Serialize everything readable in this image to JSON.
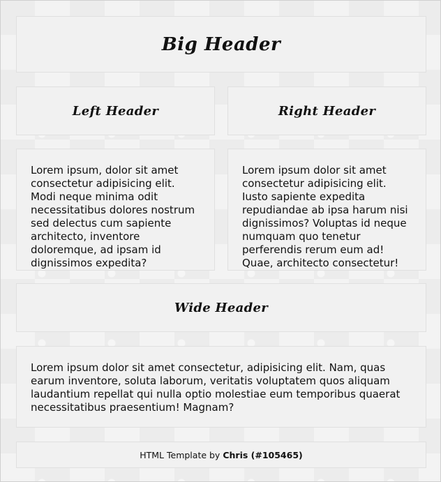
{
  "big_header": "Big Header",
  "left_header": "Left Header",
  "right_header": "Right Header",
  "left_text": "Lorem ipsum, dolor sit amet consectetur adipisicing elit. Modi neque minima odit necessitatibus dolores nostrum sed delectus cum sapiente architecto, inventore doloremque, ad ipsam id dignissimos expedita?",
  "right_text": "Lorem ipsum dolor sit amet consectetur adipisicing elit. Iusto sapiente expedita repudiandae ab ipsa harum nisi dignissimos? Voluptas id neque numquam quo tenetur perferendis rerum eum ad! Quae, architecto consectetur!",
  "wide_header": "Wide Header",
  "wide_text": "Lorem ipsum dolor sit amet consectetur, adipisicing elit. Nam, quas earum inventore, soluta laborum, veritatis voluptatem quos aliquam laudantium repellat qui nulla optio molestiae eum temporibus quaerat necessitatibus praesentium! Magnam?",
  "footer": {
    "prefix": "HTML Template by",
    "author": "Chris (#105465)"
  }
}
